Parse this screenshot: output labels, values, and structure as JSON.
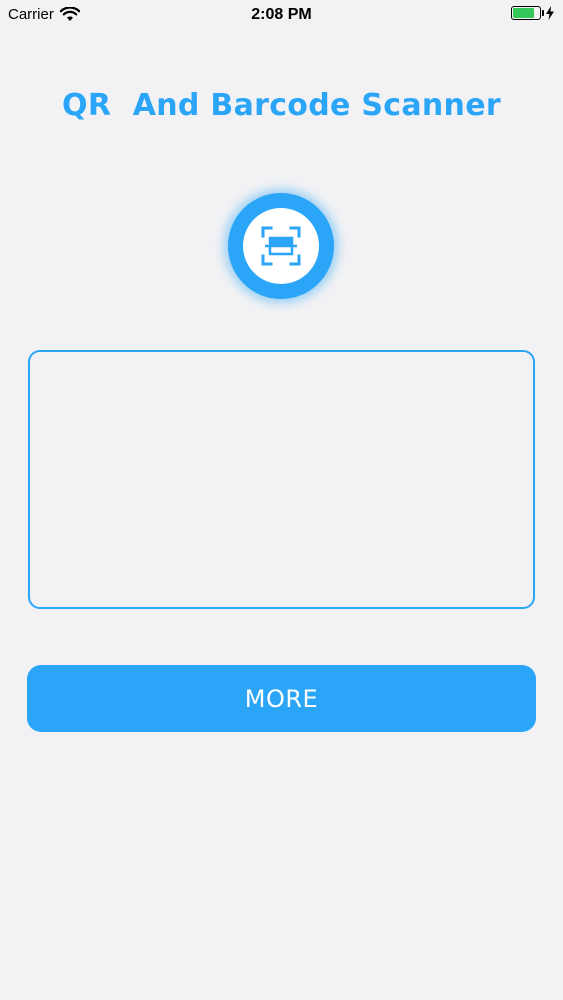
{
  "status_bar": {
    "carrier": "Carrier",
    "time": "2:08 PM",
    "wifi_icon": "wifi-icon",
    "battery_icon": "battery-icon",
    "charging_icon": "bolt-icon",
    "battery_level_percent": 82,
    "battery_color": "#35c759"
  },
  "header": {
    "title": "QR  And Barcode Scanner"
  },
  "scan": {
    "icon": "scan-frame-icon"
  },
  "result": {
    "value": "",
    "placeholder": ""
  },
  "actions": {
    "more_label": "MORE"
  },
  "colors": {
    "accent": "#2aa5f7",
    "background": "#f2f2f4",
    "button_text": "#ffffff"
  }
}
